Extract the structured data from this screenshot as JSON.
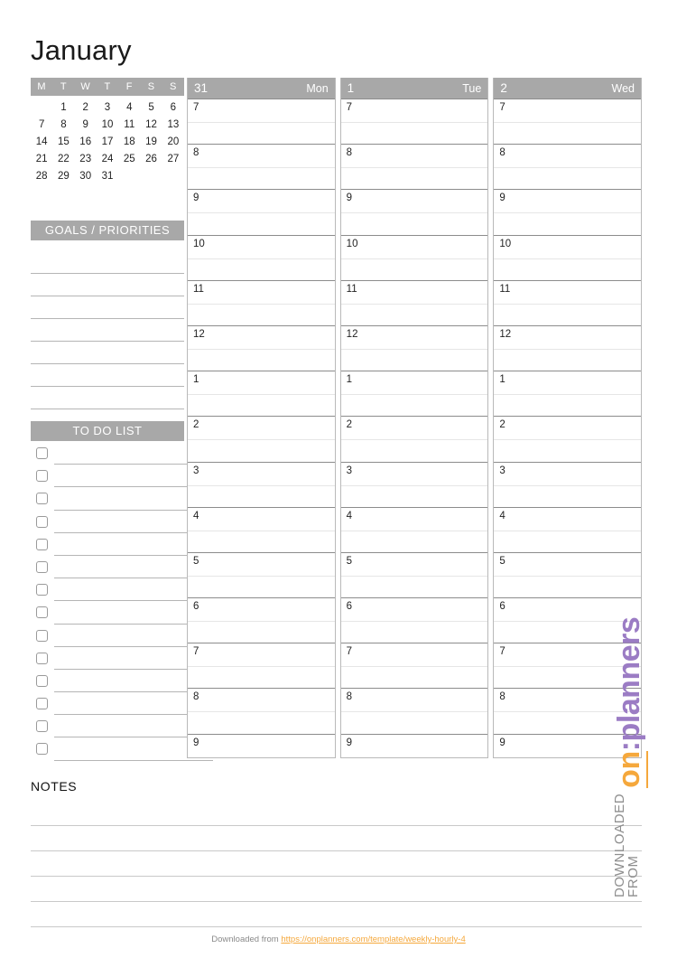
{
  "title": "January",
  "mini_calendar": {
    "weekday_headers": [
      "M",
      "T",
      "W",
      "T",
      "F",
      "S",
      "S"
    ],
    "leading_blanks": 1,
    "days": [
      1,
      2,
      3,
      4,
      5,
      6,
      7,
      8,
      9,
      10,
      11,
      12,
      13,
      14,
      15,
      16,
      17,
      18,
      19,
      20,
      21,
      22,
      23,
      24,
      25,
      26,
      27,
      28,
      29,
      30,
      31
    ]
  },
  "goals": {
    "heading": "GOALS / PRIORITIES",
    "line_count": 7
  },
  "todo": {
    "heading": "TO DO LIST",
    "row_count": 14
  },
  "day_columns": [
    {
      "date": "31",
      "weekday": "Mon",
      "hours": [
        "7",
        "8",
        "9",
        "10",
        "11",
        "12",
        "1",
        "2",
        "3",
        "4",
        "5",
        "6",
        "7",
        "8",
        "9"
      ]
    },
    {
      "date": "1",
      "weekday": "Tue",
      "hours": [
        "7",
        "8",
        "9",
        "10",
        "11",
        "12",
        "1",
        "2",
        "3",
        "4",
        "5",
        "6",
        "7",
        "8",
        "9"
      ]
    },
    {
      "date": "2",
      "weekday": "Wed",
      "hours": [
        "7",
        "8",
        "9",
        "10",
        "11",
        "12",
        "1",
        "2",
        "3",
        "4",
        "5",
        "6",
        "7",
        "8",
        "9"
      ]
    }
  ],
  "notes": {
    "heading": "NOTES",
    "line_count": 5
  },
  "watermark": {
    "from_text": "DOWNLOADED FROM",
    "logo_on": "on",
    "logo_dots": ":",
    "logo_planners": "planners"
  },
  "footer": {
    "prefix": "Downloaded from",
    "url": "https://onplanners.com/template/weekly-hourly-4"
  },
  "colors": {
    "header_gray": "#a8a8a8",
    "line_gray": "#b5b5b5",
    "accent_orange": "#f5a83c",
    "accent_purple": "#9b7cc4"
  }
}
